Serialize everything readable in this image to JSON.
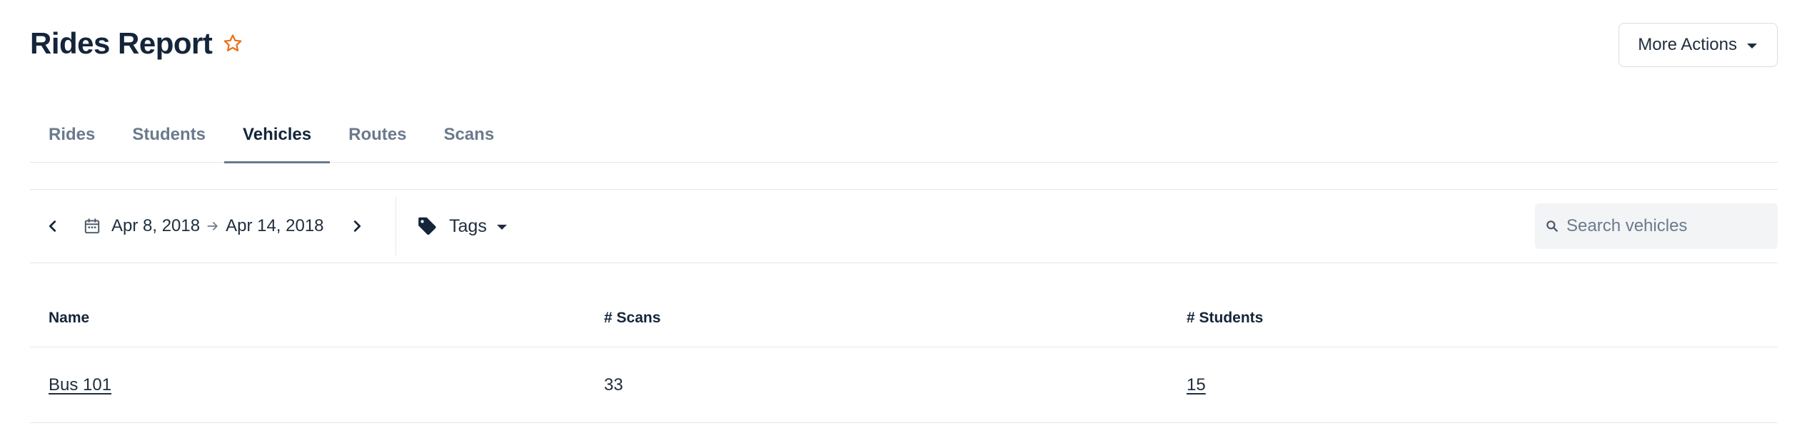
{
  "header": {
    "title": "Rides Report",
    "more_actions_label": "More Actions"
  },
  "tabs": [
    {
      "label": "Rides",
      "active": false
    },
    {
      "label": "Students",
      "active": false
    },
    {
      "label": "Vehicles",
      "active": true
    },
    {
      "label": "Routes",
      "active": false
    },
    {
      "label": "Scans",
      "active": false
    }
  ],
  "toolbar": {
    "date_start": "Apr 8, 2018",
    "date_end": "Apr 14, 2018",
    "tags_label": "Tags",
    "search_placeholder": "Search vehicles",
    "search_value": ""
  },
  "table": {
    "columns": [
      "Name",
      "# Scans",
      "# Students"
    ],
    "rows": [
      {
        "name": "Bus 101",
        "scans": "33",
        "students": "15"
      }
    ]
  },
  "colors": {
    "title": "#14253a",
    "star_accent": "#e8731a",
    "tab_inactive": "#6b7a8c",
    "border": "#e3e7ec",
    "search_bg": "#f2f4f6"
  },
  "icons": {
    "star": "star-outline-icon",
    "chevron_left": "chevron-left-icon",
    "chevron_right": "chevron-right-icon",
    "calendar": "calendar-icon",
    "arrow_right": "arrow-right-icon",
    "tag": "tag-icon",
    "search": "search-icon",
    "caret_down": "caret-down-icon"
  }
}
